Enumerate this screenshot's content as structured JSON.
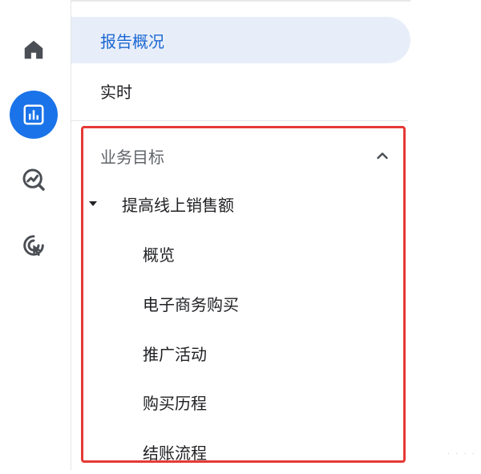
{
  "rail": {
    "items": [
      {
        "icon": "home-icon",
        "active": false
      },
      {
        "icon": "reports-icon",
        "active": true
      },
      {
        "icon": "explore-icon",
        "active": false
      },
      {
        "icon": "advertising-icon",
        "active": false
      }
    ]
  },
  "nav": {
    "top_items": [
      {
        "label": "报告概况",
        "selected": true
      },
      {
        "label": "实时",
        "selected": false
      }
    ],
    "section": {
      "title": "业务目标",
      "expanded": true,
      "group": {
        "label": "提高线上销售额",
        "items": [
          "概览",
          "电子商务购买",
          "推广活动",
          "购买历程",
          "结账流程"
        ]
      }
    }
  },
  "colors": {
    "accent": "#1a73e8",
    "selected_bg": "#e8eef9",
    "highlight": "#e53935"
  }
}
